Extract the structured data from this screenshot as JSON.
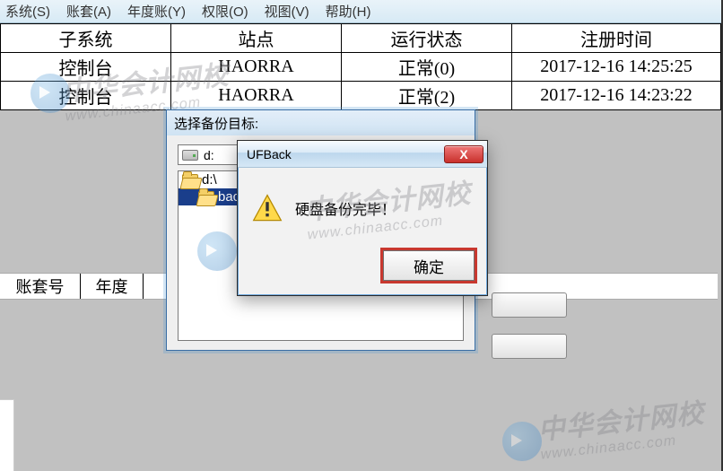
{
  "menubar": {
    "system": "系统(S)",
    "account": "账套(A)",
    "year": "年度账(Y)",
    "auth": "权限(O)",
    "view": "视图(V)",
    "help": "帮助(H)"
  },
  "grid": {
    "headers": {
      "subsystem": "子系统",
      "site": "站点",
      "status": "运行状态",
      "regtime": "注册时间"
    },
    "rows": [
      {
        "subsystem": "控制台",
        "site": "HAORRA",
        "status": "正常(0)",
        "regtime": "2017-12-16 14:25:25"
      },
      {
        "subsystem": "控制台",
        "site": "HAORRA",
        "status": "正常(2)",
        "regtime": "2017-12-16 14:23:22"
      }
    ]
  },
  "lowerbar": {
    "col1": "账套号",
    "col2": "年度"
  },
  "backup_window": {
    "title": "选择备份目标:",
    "drive_label": "d:",
    "tree": {
      "root": "d:\\",
      "child_selected": "backup"
    }
  },
  "msgbox": {
    "title": "UFBack",
    "message": "硬盘备份完毕！",
    "ok": "确定",
    "close_glyph": "X"
  },
  "watermark": {
    "brand": "中华会计网校",
    "url": "www.chinaacc.com"
  }
}
